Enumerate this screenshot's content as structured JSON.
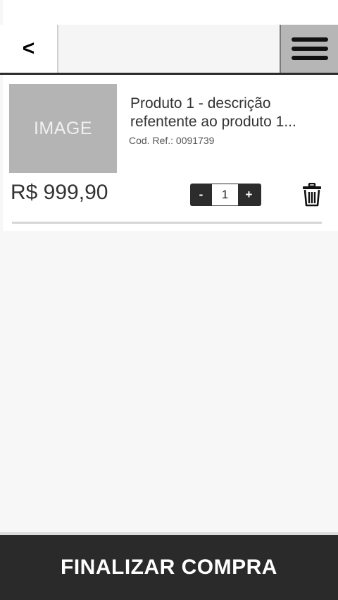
{
  "header": {
    "back_label": "<",
    "menu_icon": "hamburger-menu-icon"
  },
  "cart": {
    "items": [
      {
        "image_placeholder": "IMAGE",
        "title": "Produto 1 - descrição refentente ao produto 1...",
        "ref": "Cod. Ref.: 0091739",
        "price": "R$ 999,90",
        "qty_minus": "-",
        "qty_value": "1",
        "qty_plus": "+",
        "remove_icon": "trash-icon"
      }
    ]
  },
  "footer": {
    "checkout_label": "FINALIZAR COMPRA"
  },
  "colors": {
    "footer_bg": "#2a2a2a",
    "menu_bg": "#b6b6b6",
    "qty_bg": "#2c2c2c"
  }
}
